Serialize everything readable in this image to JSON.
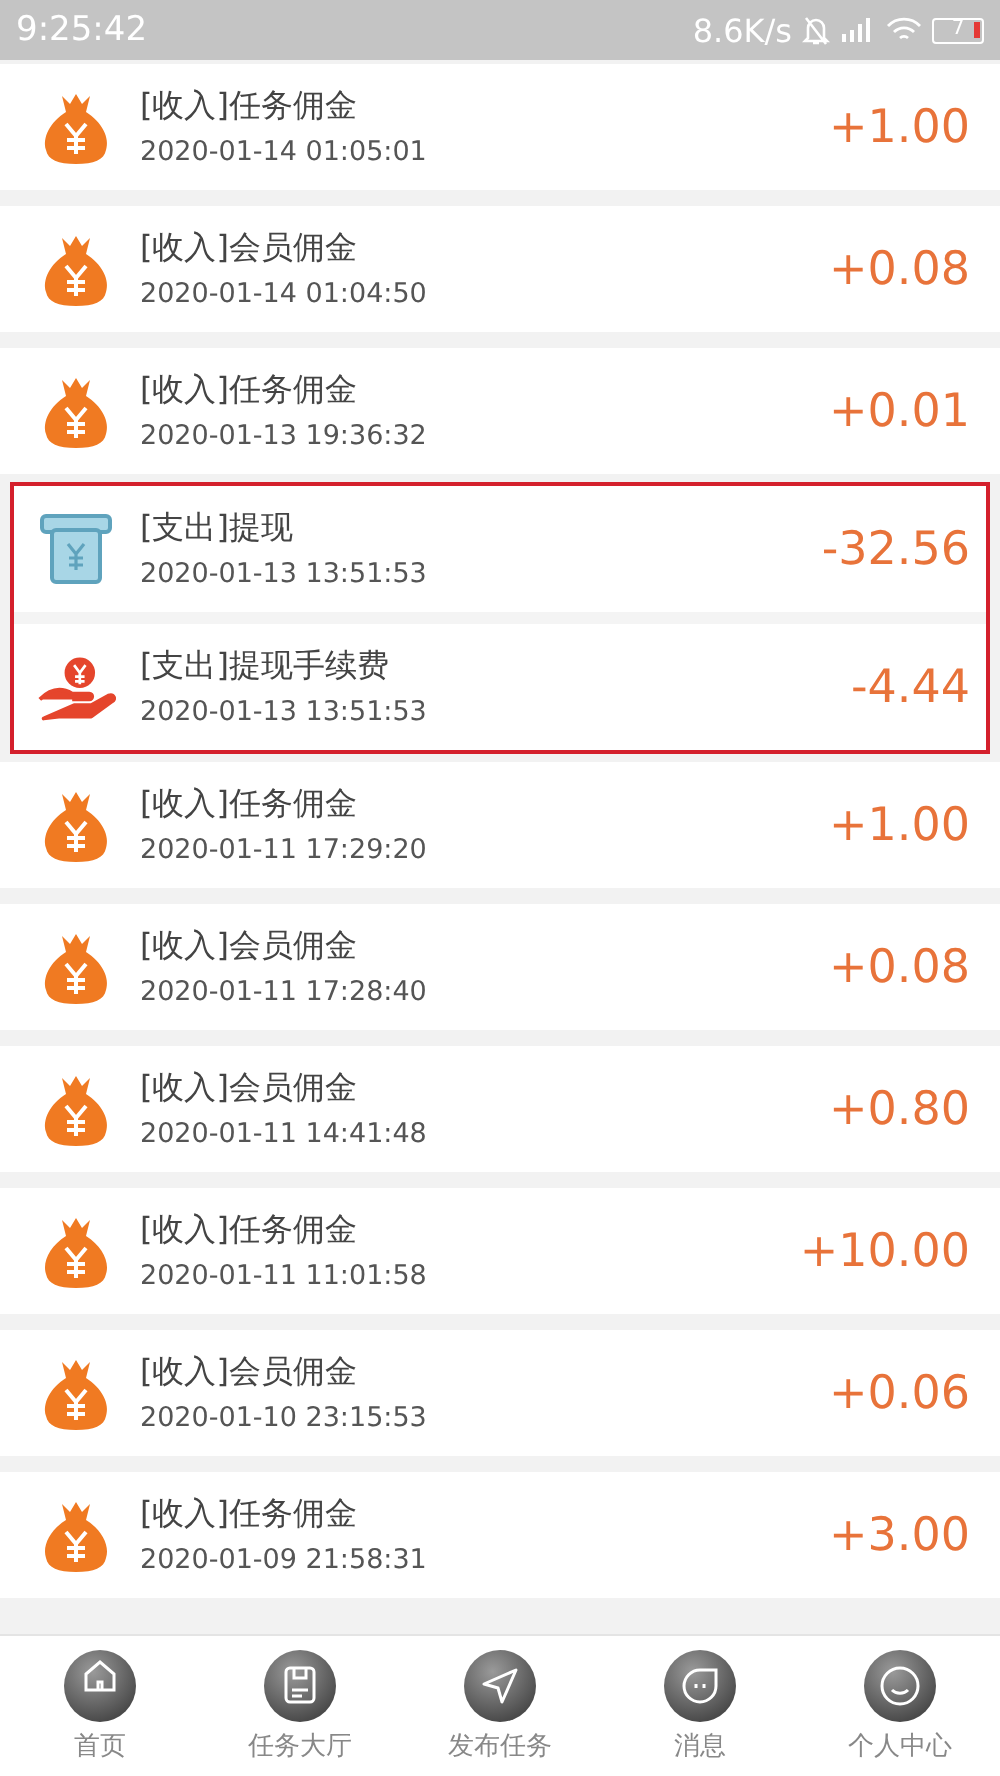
{
  "status_bar": {
    "time": "9:25:42",
    "speed": "8.6K/s",
    "battery": "7"
  },
  "records": [
    {
      "kind": "income",
      "title": "[收入]任务佣金",
      "time": "2020-01-14 01:05:01",
      "amount": "+1.00",
      "highlighted": false
    },
    {
      "kind": "income",
      "title": "[收入]会员佣金",
      "time": "2020-01-14 01:04:50",
      "amount": "+0.08",
      "highlighted": false
    },
    {
      "kind": "income",
      "title": "[收入]任务佣金",
      "time": "2020-01-13 19:36:32",
      "amount": "+0.01",
      "highlighted": false
    },
    {
      "kind": "withdraw",
      "title": "[支出]提现",
      "time": "2020-01-13 13:51:53",
      "amount": "-32.56",
      "highlighted": true
    },
    {
      "kind": "fee",
      "title": "[支出]提现手续费",
      "time": "2020-01-13 13:51:53",
      "amount": "-4.44",
      "highlighted": true
    },
    {
      "kind": "income",
      "title": "[收入]任务佣金",
      "time": "2020-01-11 17:29:20",
      "amount": "+1.00",
      "highlighted": false
    },
    {
      "kind": "income",
      "title": "[收入]会员佣金",
      "time": "2020-01-11 17:28:40",
      "amount": "+0.08",
      "highlighted": false
    },
    {
      "kind": "income",
      "title": "[收入]会员佣金",
      "time": "2020-01-11 14:41:48",
      "amount": "+0.80",
      "highlighted": false
    },
    {
      "kind": "income",
      "title": "[收入]任务佣金",
      "time": "2020-01-11 11:01:58",
      "amount": "+10.00",
      "highlighted": false
    },
    {
      "kind": "income",
      "title": "[收入]会员佣金",
      "time": "2020-01-10 23:15:53",
      "amount": "+0.06",
      "highlighted": false
    },
    {
      "kind": "income",
      "title": "[收入]任务佣金",
      "time": "2020-01-09 21:58:31",
      "amount": "+3.00",
      "highlighted": false
    }
  ],
  "tab_bar": [
    {
      "kind": "home",
      "label": "首页"
    },
    {
      "kind": "tasks",
      "label": "任务大厅"
    },
    {
      "kind": "publish",
      "label": "发布任务"
    },
    {
      "kind": "messages",
      "label": "消息"
    },
    {
      "kind": "profile",
      "label": "个人中心"
    }
  ]
}
